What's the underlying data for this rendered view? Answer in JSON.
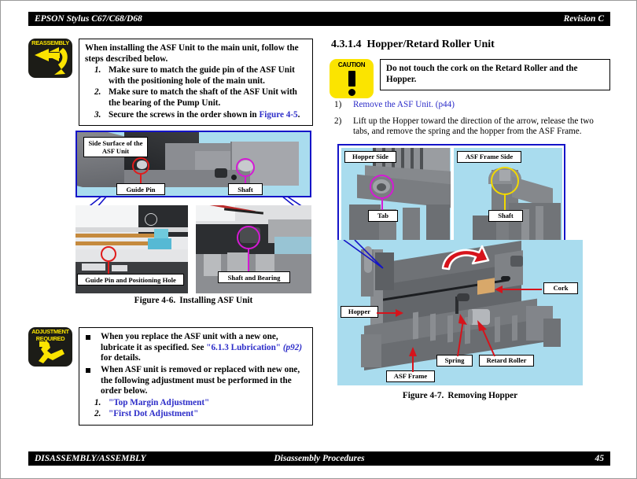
{
  "header": {
    "left": "EPSON Stylus C67/C68/D68",
    "right": "Revision C"
  },
  "footer": {
    "left": "DISASSEMBLY/ASSEMBLY",
    "center": "Disassembly Procedures",
    "right": "45"
  },
  "left_column": {
    "reassembly_note": {
      "icon_label": "REASSEMBLY",
      "icon_name": "curved-arrow-icon",
      "intro": "When installing the ASF Unit to the main unit, follow the steps described below.",
      "steps": [
        {
          "num": "1.",
          "text_before": "Make sure to match the guide pin of the ASF Unit with the positioning hole of the main unit.",
          "link": "",
          "text_after": ""
        },
        {
          "num": "2.",
          "text_before": "Make sure to match the shaft of the ASF Unit with the bearing of the Pump Unit.",
          "link": "",
          "text_after": ""
        },
        {
          "num": "3.",
          "text_before": "Secure the screws in the order shown in ",
          "link": "Figure 4-5",
          "text_after": "."
        }
      ]
    },
    "figure_46": {
      "caption_label": "Figure 4-6.",
      "caption_text": "Installing ASF Unit",
      "labels": {
        "side_surface_line1": "Side Surface of the",
        "side_surface_line2": "ASF Unit",
        "guide_pin": "Guide Pin",
        "shaft": "Shaft",
        "guide_pin_hole": "Guide Pin and Positioning Hole",
        "shaft_bearing": "Shaft and Bearing"
      },
      "colors": {
        "photo_bg": "#a9dcee",
        "red_circle": "#e01b1b",
        "magenta_circle": "#d41ad4",
        "box_border": "#1414c8"
      }
    },
    "adjustment_note": {
      "icon_label_line1": "ADJUSTMENT",
      "icon_label_line2": "REQUIRED",
      "icon_name": "wrench-icon",
      "bullets": [
        {
          "pre": "When you replace the ASF unit with a new one, lubricate it as specified. See ",
          "link": "\"6.1.3 Lubrication\"",
          "mid": " ",
          "link2": "(p92)",
          "post": " for details."
        },
        {
          "pre": "When ASF unit is removed or replaced with new one, the following adjustment must be performed in the order below.",
          "link": "",
          "mid": "",
          "link2": "",
          "post": ""
        }
      ],
      "sub_steps": [
        {
          "num": "1.",
          "text": "\"Top Margin Adjustment\""
        },
        {
          "num": "2.",
          "text": "\"First Dot Adjustment\""
        }
      ]
    }
  },
  "right_column": {
    "section": {
      "number": "4.3.1.4",
      "title": "Hopper/Retard Roller Unit"
    },
    "caution": {
      "icon_label": "CAUTION",
      "icon_name": "exclamation-icon",
      "text": "Do not touch the cork on the Retard Roller and the Hopper."
    },
    "procedure": [
      {
        "num": "1)",
        "pre": "",
        "link": "Remove the ASF Unit. (p44)",
        "post": ""
      },
      {
        "num": "2)",
        "pre": "Lift up the Hopper toward the direction of the arrow, release the two tabs, and remove the spring and the hopper from the ASF Frame.",
        "link": "",
        "post": ""
      }
    ],
    "figure_47": {
      "caption_label": "Figure 4-7.",
      "caption_text": "Removing Hopper",
      "labels": {
        "hopper_side": "Hopper Side",
        "asf_frame_side": "ASF Frame Side",
        "tab": "Tab",
        "shaft": "Shaft",
        "hopper": "Hopper",
        "cork": "Cork",
        "spring": "Spring",
        "retard_roller": "Retard Roller",
        "asf_frame": "ASF Frame"
      },
      "colors": {
        "photo_bg": "#a9dcee",
        "magenta_circle": "#d41ad4",
        "yellow_circle": "#f2d900",
        "red_arrow": "#d6131b",
        "box_border": "#1414c8"
      }
    }
  }
}
